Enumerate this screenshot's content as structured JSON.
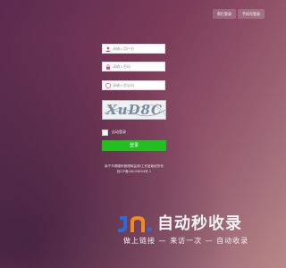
{
  "header": {
    "left_button": "帮忙登录",
    "right_button": "手机号登录"
  },
  "form": {
    "username_placeholder": "请输入用户名",
    "password_placeholder": "请输入密码",
    "code_placeholder": "请输入验证码",
    "captcha_text": "XuD8C",
    "remember_label": "自动登录",
    "login_label": "登录"
  },
  "footer": {
    "line1": "南宁市健康码管理局监测/工作室版权所有",
    "line2": "桂ICP备16043694号-1"
  },
  "watermark": {
    "title": "自动秒收录",
    "subtitle": "做上链接 — 来访一次 — 自动收录"
  },
  "colors": {
    "login_button": "#1fc01f",
    "logo_blue": "#2c6bd6",
    "logo_orange": "#f08a24"
  },
  "icons": [
    "user-icon",
    "lock-icon",
    "shield-icon"
  ]
}
